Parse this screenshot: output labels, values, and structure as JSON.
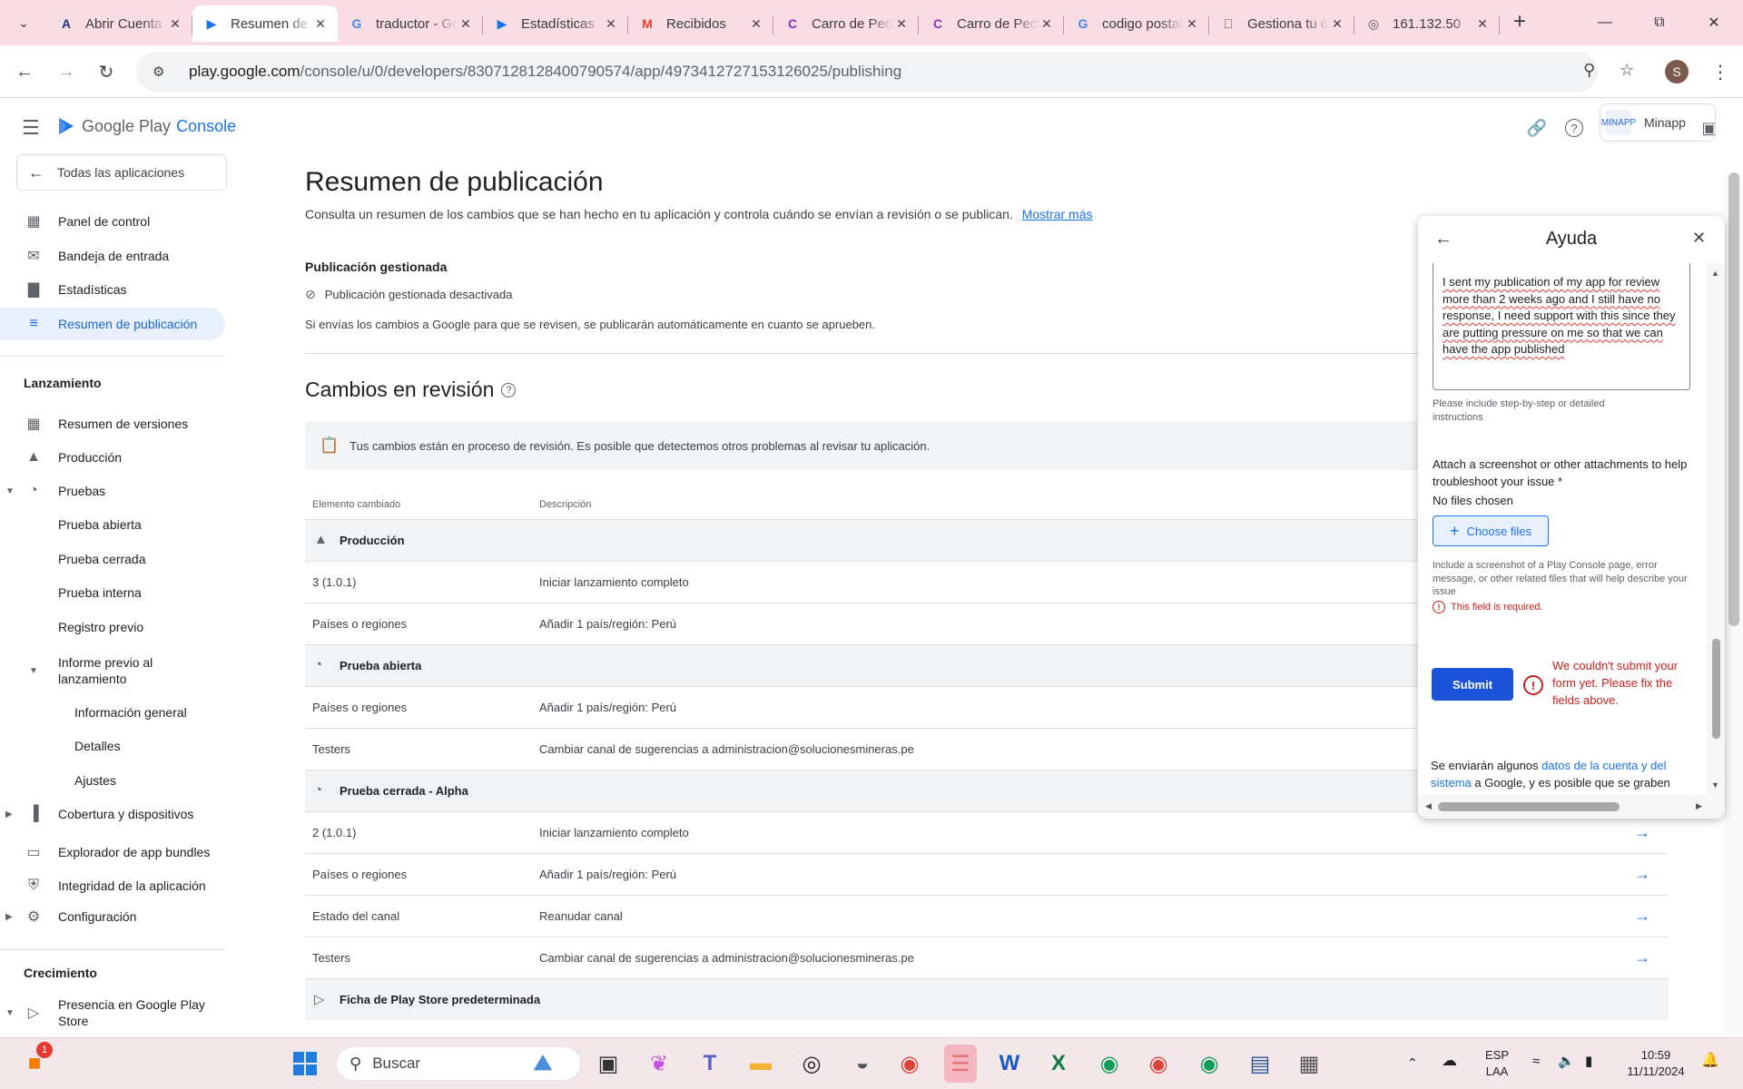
{
  "browser": {
    "tabs": [
      {
        "title": "Abrir Cuenta",
        "favicon": "A",
        "color": "#1e3a8a",
        "active": false
      },
      {
        "title": "Resumen de publicación",
        "favicon": "play-console",
        "color": "#1a73e8",
        "active": true
      },
      {
        "title": "traductor - Google",
        "favicon": "G",
        "color": "#4285f4",
        "active": false
      },
      {
        "title": "Estadísticas",
        "favicon": "play-console",
        "color": "#1a73e8",
        "active": false
      },
      {
        "title": "Recibidos",
        "favicon": "M",
        "color": "#ea4335",
        "active": false
      },
      {
        "title": "Carro de Pedidos",
        "favicon": "C",
        "color": "#8b2fc9",
        "active": false
      },
      {
        "title": "Carro de Pedidos",
        "favicon": "C",
        "color": "#8b2fc9",
        "active": false
      },
      {
        "title": "codigo postal",
        "favicon": "G",
        "color": "#4285f4",
        "active": false
      },
      {
        "title": "Gestiona tu cuenta",
        "favicon": "apple",
        "color": "#555555",
        "active": false
      },
      {
        "title": "161.132.50",
        "favicon": "globe",
        "color": "#555555",
        "active": false
      }
    ],
    "url_host": "play.google.com",
    "url_path": "/console/u/0/developers/8307128128400790574/app/4973412727153126025/publishing",
    "profile_initial": "S"
  },
  "header": {
    "product_google": "Google Play",
    "product_console": "Console",
    "account_name": "Minapp",
    "account_logo_text": "MINAPP"
  },
  "sidebar": {
    "all_apps": "Todas las aplicaciones",
    "items_top": [
      {
        "label": "Panel de control",
        "icon": "dashboard-icon"
      },
      {
        "label": "Bandeja de entrada",
        "icon": "inbox-icon"
      },
      {
        "label": "Estadísticas",
        "icon": "bar-chart-icon"
      },
      {
        "label": "Resumen de publicación",
        "icon": "publishing-icon",
        "active": true
      }
    ],
    "section_launch": "Lanzamiento",
    "launch_items": [
      {
        "label": "Resumen de versiones",
        "icon": "grid-icon"
      },
      {
        "label": "Producción",
        "icon": "production-icon"
      },
      {
        "label": "Pruebas",
        "icon": "testing-icon",
        "expanded": true
      },
      {
        "label": "Prueba abierta",
        "level": 1
      },
      {
        "label": "Prueba cerrada",
        "level": 1
      },
      {
        "label": "Prueba interna",
        "level": 1
      },
      {
        "label": "Registro previo",
        "level": 1
      },
      {
        "label": "Informe previo al lanzamiento",
        "level": 1,
        "expanded": true
      },
      {
        "label": "Información general",
        "level": 2
      },
      {
        "label": "Detalles",
        "level": 2
      },
      {
        "label": "Ajustes",
        "level": 2
      },
      {
        "label": "Cobertura y dispositivos",
        "icon": "devices-icon",
        "collapsed": true
      },
      {
        "label": "Explorador de app bundles",
        "icon": "bundle-icon"
      },
      {
        "label": "Integridad de la aplicación",
        "icon": "shield-icon"
      },
      {
        "label": "Configuración",
        "icon": "gear-icon",
        "collapsed": true
      }
    ],
    "section_growth": "Crecimiento",
    "growth_items": [
      {
        "label": "Presencia en Google Play Store",
        "icon": "store-icon",
        "expanded": true
      }
    ]
  },
  "main": {
    "title": "Resumen de publicación",
    "subtitle": "Consulta un resumen de los cambios que se han hecho en tu aplicación y controla cuándo se envían a revisión o se publican.",
    "learn_more": "Mostrar más",
    "managed_heading": "Publicación gestionada",
    "managed_status": "Publicación gestionada desactivada",
    "managed_desc": "Si envías los cambios a Google para que se revisen, se publicarán automáticamente en cuanto se aprueben.",
    "changes_title": "Cambios en revisión",
    "banner": "Tus cambios están en proceso de revisión. Es posible que detectemos otros problemas al revisar tu aplicación.",
    "col_item": "Elemento cambiado",
    "col_desc": "Descripción",
    "rows": [
      {
        "group": true,
        "icon": "production-icon",
        "item": "Producción"
      },
      {
        "item": "3 (1.0.1)",
        "desc": "Iniciar lanzamiento completo",
        "arrow": false
      },
      {
        "item": "Países o regiones",
        "desc": "Añadir 1 país/región: Perú",
        "arrow": false
      },
      {
        "group": true,
        "icon": "testing-icon",
        "item": "Prueba abierta"
      },
      {
        "item": "Países o regiones",
        "desc": "Añadir 1 país/región: Perú",
        "arrow": false
      },
      {
        "item": "Testers",
        "desc": "Cambiar canal de sugerencias a administracion@solucionesmineras.pe",
        "arrow": false
      },
      {
        "group": true,
        "icon": "testing-icon",
        "item": "Prueba cerrada - Alpha"
      },
      {
        "item": "2 (1.0.1)",
        "desc": "Iniciar lanzamiento completo",
        "arrow": true
      },
      {
        "item": "Países o regiones",
        "desc": "Añadir 1 país/región: Perú",
        "arrow": true
      },
      {
        "item": "Estado del canal",
        "desc": "Reanudar canal",
        "arrow": true
      },
      {
        "item": "Testers",
        "desc": "Cambiar canal de sugerencias a administracion@solucionesmineras.pe",
        "arrow": true
      },
      {
        "group": true,
        "icon": "store-icon",
        "item": "Ficha de Play Store predeterminada"
      }
    ]
  },
  "help": {
    "title": "Ayuda",
    "message": "I sent my publication of my app for review more than 2 weeks ago and I still have no response, I need support with this since they are putting pressure on me so that we can have the app published",
    "message_hint": "Please include step-by-step or detailed instructions",
    "attach_label": "Attach a screenshot or other attachments to help troubleshoot your issue *",
    "no_files": "No files chosen",
    "choose_files": "Choose files",
    "attach_hint": "Include a screenshot of a Play Console page, error message, or other related files that will help describe your issue",
    "field_required": "This field is required.",
    "submit": "Submit",
    "submit_error": "We couldn't submit your form yet. Please fix the fields above.",
    "footer_pre": "Se enviarán algunos ",
    "footer_link": "datos de la cuenta y del sistema",
    "footer_post": " a Google, y es posible que se graben llamadas y chats de asistencia. Utiliza"
  },
  "taskbar": {
    "search_placeholder": "Buscar",
    "notification_badge": "1",
    "lang_top": "ESP",
    "lang_bottom": "LAA",
    "time": "10:59",
    "date": "11/11/2024"
  }
}
